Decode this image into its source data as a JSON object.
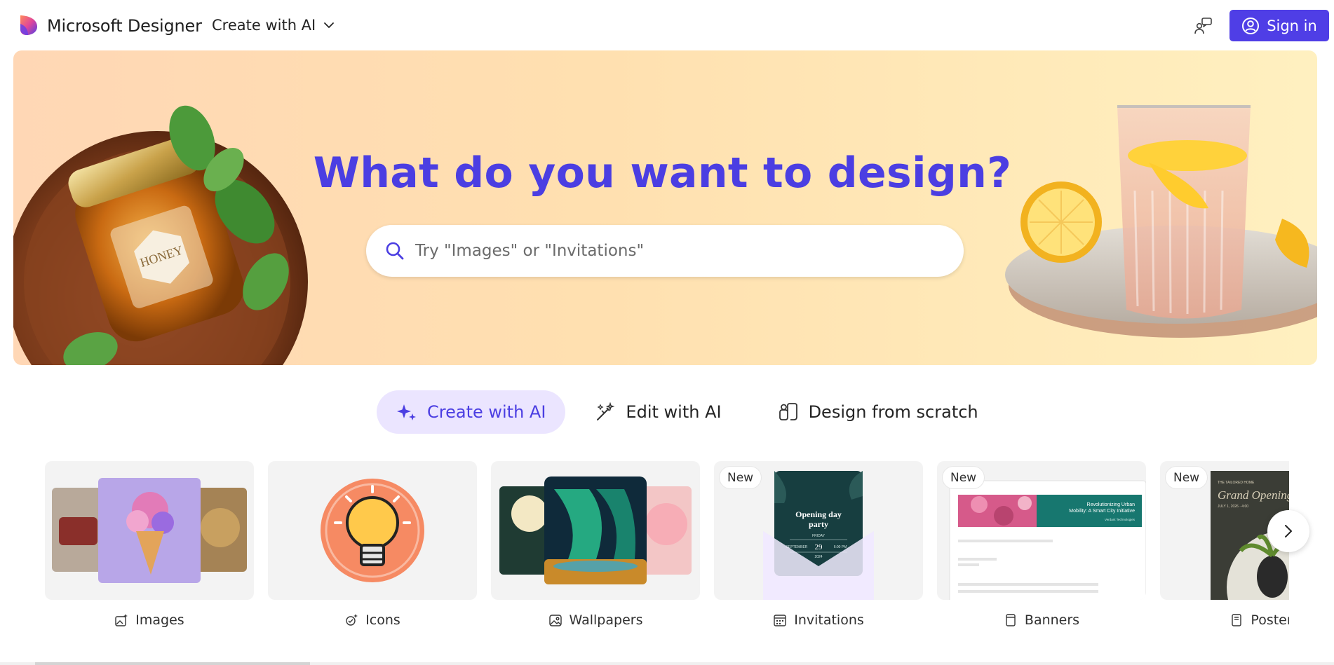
{
  "header": {
    "brand": "Microsoft Designer",
    "create_menu_label": "Create with AI",
    "sign_in_label": "Sign in",
    "brand_gradient": [
      "#ff6b6b",
      "#b13cff",
      "#4f3ee6"
    ],
    "accent_color": "#4f3ee6"
  },
  "hero": {
    "title": "What do you want to design?",
    "search": {
      "placeholder": "Try \"Images\" or \"Invitations\"",
      "value": ""
    },
    "left_art_text": "HONEY",
    "title_color": "#4b3ee2"
  },
  "modes": [
    {
      "label": "Create with AI",
      "icon": "sparkle-icon",
      "active": true
    },
    {
      "label": "Edit with AI",
      "icon": "magic-wand-icon",
      "active": false
    },
    {
      "label": "Design from scratch",
      "icon": "shapes-icon",
      "active": false
    }
  ],
  "cards": [
    {
      "label": "Images",
      "icon": "image-sparkle-icon",
      "badge": ""
    },
    {
      "label": "Icons",
      "icon": "icon-sparkle-icon",
      "badge": ""
    },
    {
      "label": "Wallpapers",
      "icon": "wallpaper-icon",
      "badge": ""
    },
    {
      "label": "Invitations",
      "icon": "calendar-icon",
      "badge": "New",
      "thumb_text": {
        "title": "Opening day party",
        "friday": "FRIDAY",
        "month": "SEPTEMBER",
        "day": "29",
        "time": "6:00 PM",
        "year": "2024"
      }
    },
    {
      "label": "Banners",
      "icon": "banner-icon",
      "badge": "New",
      "thumb_text": {
        "headline": "Revolutionizing Urban Mobility: A Smart City Initiative",
        "byline": "Verdant Technologies"
      }
    },
    {
      "label": "Posters",
      "icon": "poster-icon",
      "badge": "New",
      "thumb_text": {
        "kicker": "THE TAILORED HOME",
        "title": "Grand Opening",
        "date": "JULY 1, 2026 · 4:00"
      }
    }
  ]
}
